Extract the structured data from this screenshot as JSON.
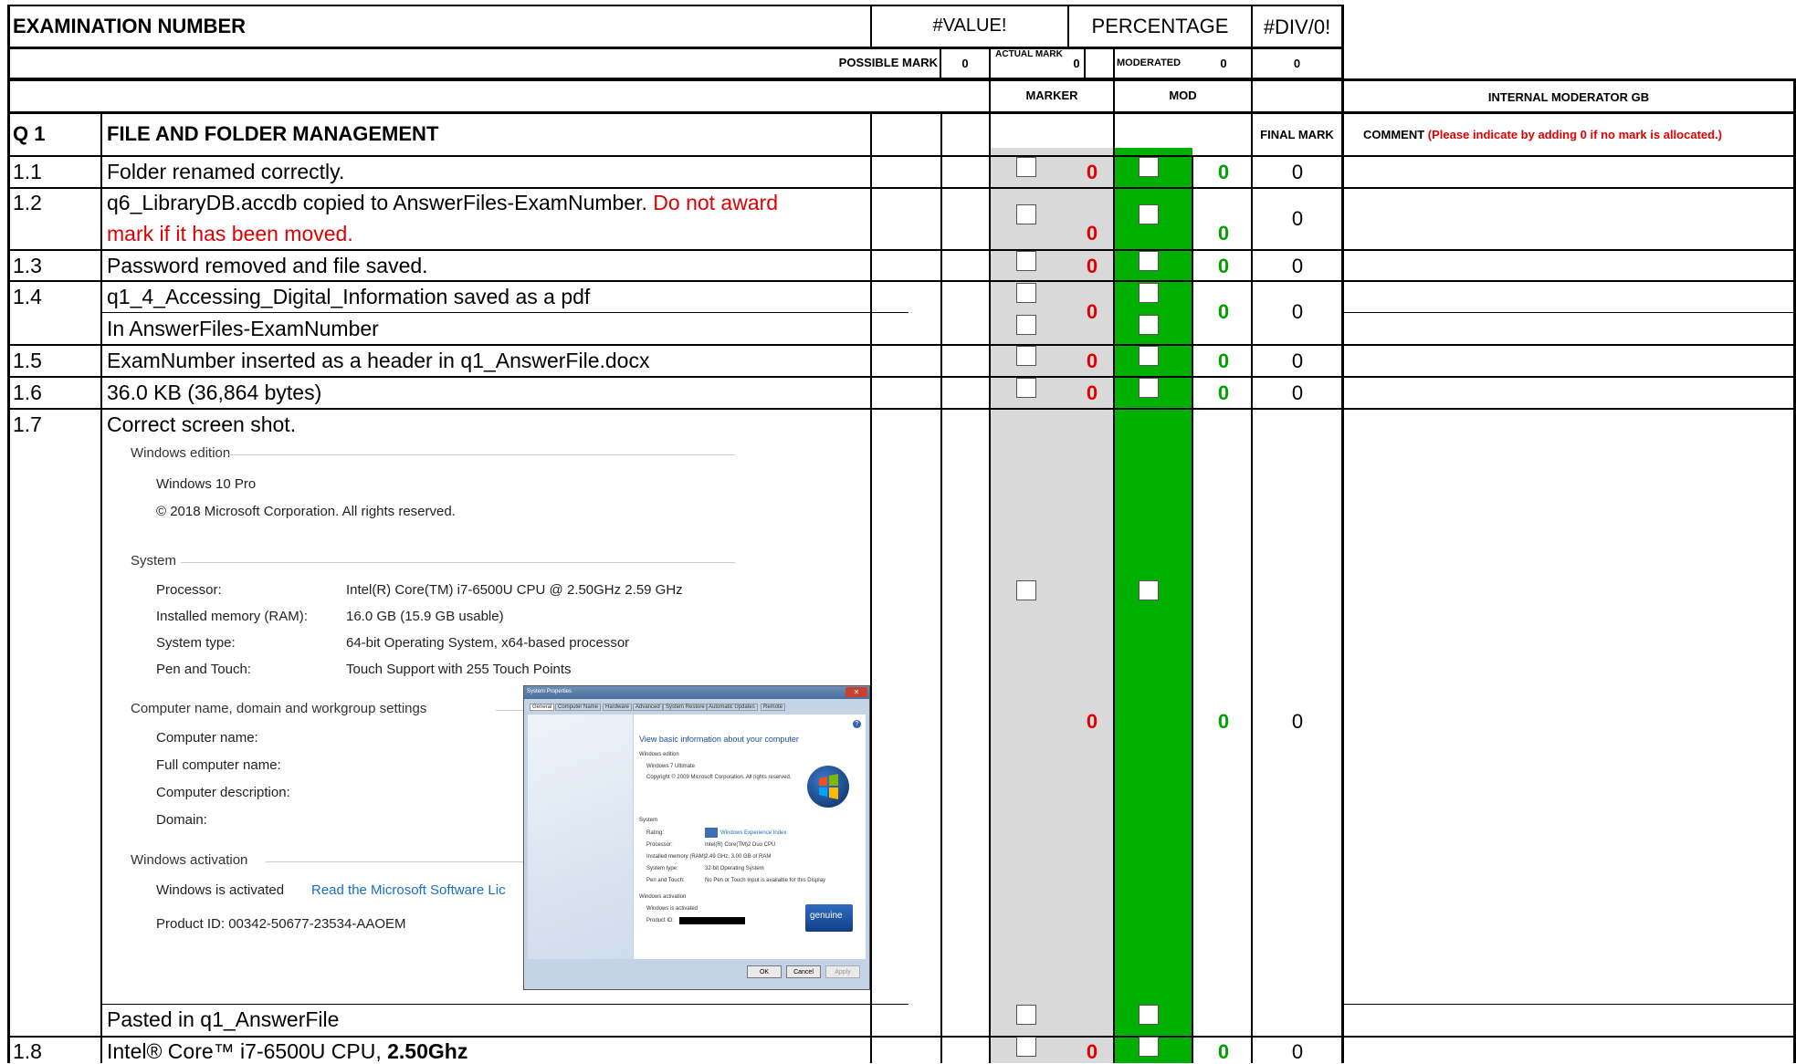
{
  "header": {
    "exam_number_label": "EXAMINATION NUMBER",
    "value_error": "#VALUE!",
    "percentage_label": "PERCENTAGE",
    "div_error": "#DIV/0!",
    "possible_mark_label": "POSSIBLE MARK",
    "possible_mark_value": "0",
    "actual_mark_label": "ACTUAL MARK",
    "actual_mark_value": "0",
    "moderated_label": "MODERATED",
    "moderated_value": "0",
    "total_value": "0",
    "marker_label": "MARKER",
    "mod_label": "MOD",
    "internal_moderator_label": "INTERNAL MODERATOR GB",
    "final_mark_label": "FINAL MARK",
    "comment_label": "COMMENT",
    "comment_note": "(Please indicate by adding 0 if no mark is allocated.)"
  },
  "section": {
    "number": "Q 1",
    "title": "FILE AND FOLDER MANAGEMENT"
  },
  "rows": [
    {
      "num": "1.1",
      "text": "Folder renamed correctly.",
      "marker": "0",
      "mod": "0",
      "final": "0"
    },
    {
      "num": "1.2",
      "text": "q6_LibraryDB.accdb copied to AnswerFiles-ExamNumber.",
      "note_line1": "Do not award",
      "note_line2": "mark if it has been moved.",
      "marker": "0",
      "mod": "0",
      "final": "0"
    },
    {
      "num": "1.3",
      "text": "Password removed and file saved.",
      "marker": "0",
      "mod": "0",
      "final": "0"
    },
    {
      "num": "1.4",
      "text": "q1_4_Accessing_Digital_Information saved as a pdf",
      "sub": "In AnswerFiles-ExamNumber",
      "marker": "0",
      "mod": "0",
      "final": "0"
    },
    {
      "num": "1.5",
      "text": "ExamNumber inserted as a header in q1_AnswerFile.docx",
      "marker": "0",
      "mod": "0",
      "final": "0"
    },
    {
      "num": "1.6",
      "text": "36.0 KB (36,864 bytes)",
      "marker": "0",
      "mod": "0",
      "final": "0"
    },
    {
      "num": "1.7",
      "text": "Correct screen shot.",
      "sub": "Pasted in q1_AnswerFile",
      "marker": "0",
      "mod": "0",
      "final": "0"
    },
    {
      "num": "1.8",
      "text": "Intel® Core™ i7-6500U CPU, ",
      "bold": "2.50Ghz",
      "marker": "0",
      "mod": "0",
      "final": "0"
    }
  ],
  "win10": {
    "edition_heading": "Windows edition",
    "edition": "Windows 10 Pro",
    "copyright": "© 2018 Microsoft Corporation. All rights reserved.",
    "system_heading": "System",
    "processor_label": "Processor:",
    "processor": "Intel(R) Core(TM) i7-6500U CPU @ 2.50GHz   2.59 GHz",
    "ram_label": "Installed memory (RAM):",
    "ram": "16.0 GB (15.9 GB usable)",
    "type_label": "System type:",
    "type": "64-bit Operating System, x64-based processor",
    "pen_label": "Pen and Touch:",
    "pen": "Touch Support with 255 Touch Points",
    "name_heading": "Computer name, domain and workgroup settings",
    "computer_name": "Computer name:",
    "full_name": "Full computer name:",
    "description": "Computer description:",
    "domain": "Domain:",
    "activation_heading": "Windows activation",
    "activated": "Windows is activated",
    "license_link": "Read the Microsoft Software Lic",
    "product_id": "Product ID:  00342-50677-23534-AAOEM"
  },
  "win7": {
    "title": "System Properties",
    "tabs": [
      "General",
      "Computer Name",
      "Hardware",
      "Advanced",
      "System Restore",
      "Automatic Updates",
      "Remote"
    ],
    "heading": "View basic information about your computer",
    "edition_heading": "Windows edition",
    "edition": "Windows 7 Ultimate",
    "copyright": "Copyright © 2009 Microsoft Corporation.  All rights reserved.",
    "system_heading": "System",
    "rating_label": "Rating:",
    "rating": "Windows Experience Index",
    "processor_label": "Processor:",
    "processor": "Intel(R) Core(TM)2 Duo CPU",
    "ram_label": "Installed memory (RAM):",
    "ram": "2.49 GHz, 3.00 GB of RAM",
    "type_label": "System type:",
    "type": "32-bit Operating System",
    "pen_label": "Pen and Touch:",
    "pen": "No Pen or Touch Input is available for this Display",
    "activation_heading": "Windows activation",
    "activated": "Windows is activated",
    "product_id": "Product ID:",
    "genuine": "genuine",
    "ok": "OK",
    "cancel": "Cancel",
    "apply": "Apply"
  },
  "colors": {
    "marker_fill": "#d9d9d9",
    "mod_fill": "#00b000",
    "red": "#e00000",
    "green": "#00a000"
  }
}
